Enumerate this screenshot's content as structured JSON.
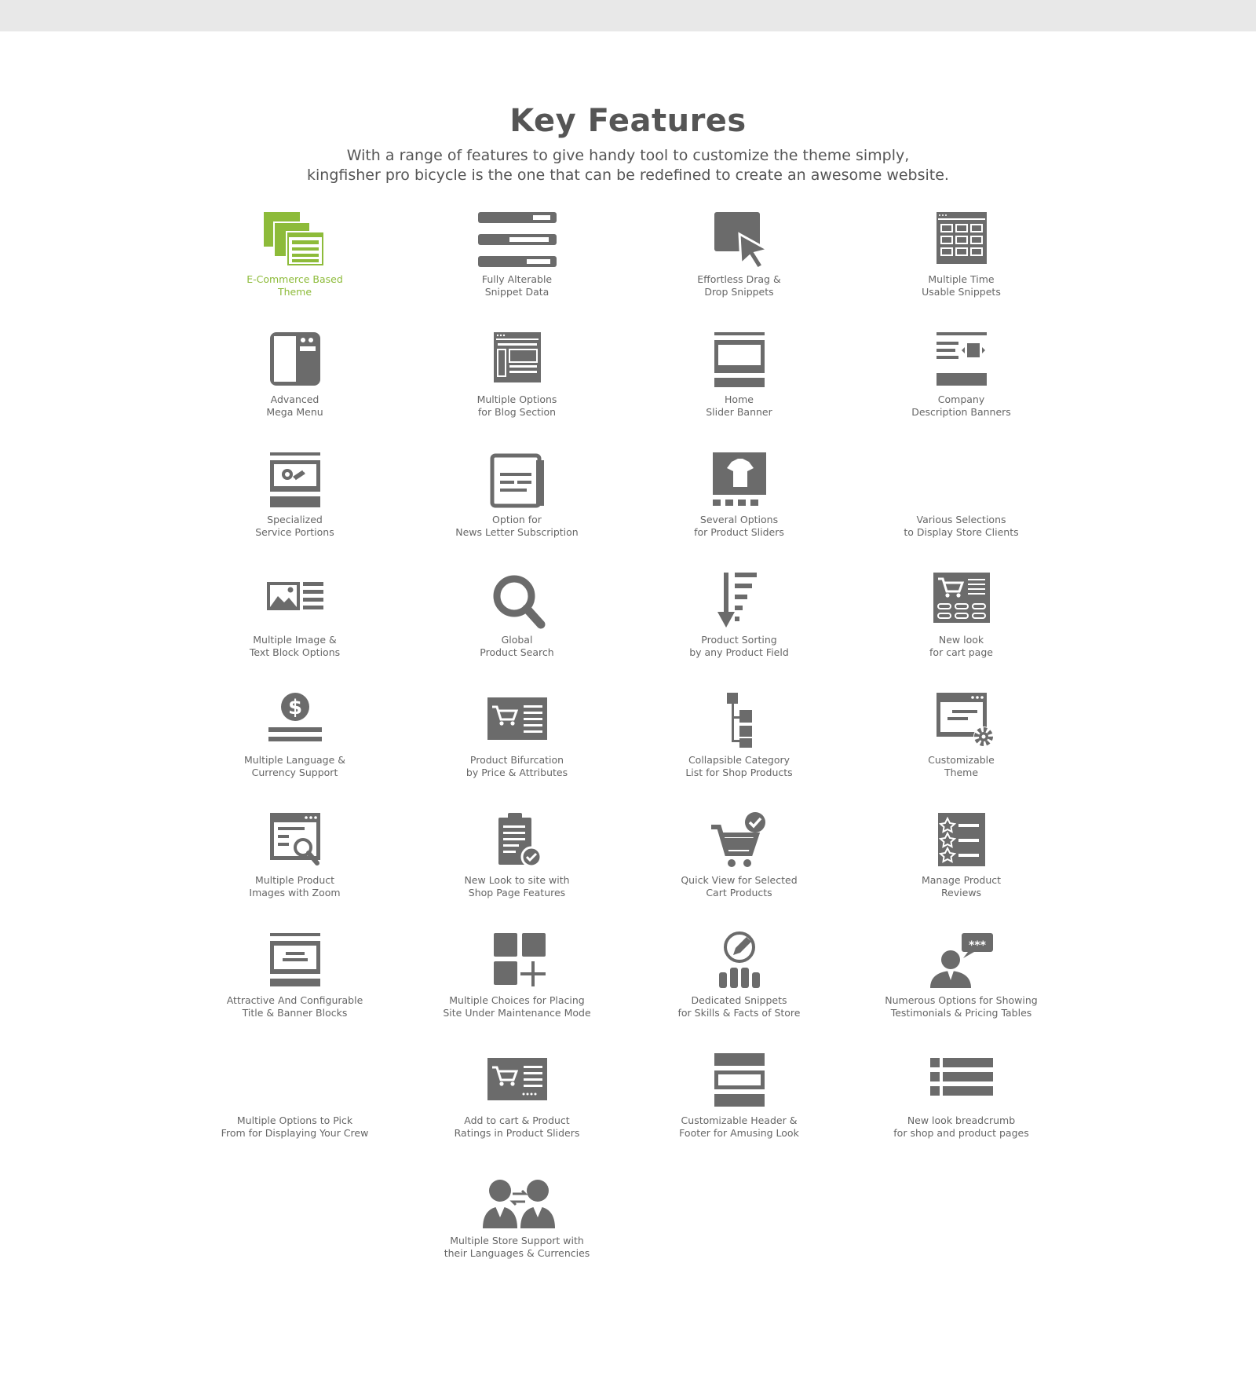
{
  "header": {
    "title": "Key Features",
    "subtitle_line1": "With a range of features to give handy tool to customize the theme simply,",
    "subtitle_line2": "kingfisher pro bicycle is the one that can be redefined to create an awesome website."
  },
  "colors": {
    "icon_gray": "#6b6b6b",
    "accent_green": "#8dbb3a",
    "text_gray": "#555555",
    "topbar": "#e8e8e8"
  },
  "features": [
    {
      "icon": "ecommerce-windows-icon",
      "line1": "E-Commerce Based",
      "line2": "Theme",
      "active": true
    },
    {
      "icon": "snippet-bars-icon",
      "line1": "Fully Alterable",
      "line2": "Snippet Data"
    },
    {
      "icon": "drag-drop-cursor-icon",
      "line1": "Effortless Drag &",
      "line2": "Drop Snippets"
    },
    {
      "icon": "snippet-grid-icon",
      "line1": "Multiple Time",
      "line2": "Usable Snippets"
    },
    {
      "icon": "mega-menu-icon",
      "line1": "Advanced",
      "line2": "Mega Menu"
    },
    {
      "icon": "blog-layout-icon",
      "line1": "Multiple Options",
      "line2": "for Blog Section"
    },
    {
      "icon": "slider-banner-icon",
      "line1": "Home",
      "line2": "Slider Banner"
    },
    {
      "icon": "description-banner-icon",
      "line1": "Company",
      "line2": "Description Banners"
    },
    {
      "icon": "service-portion-icon",
      "line1": "Specialized",
      "line2": "Service Portions"
    },
    {
      "icon": "newsletter-icon",
      "line1": "Option for",
      "line2": "News Letter Subscription"
    },
    {
      "icon": "product-slider-icon",
      "line1": "Several Options",
      "line2": "for Product Sliders"
    },
    {
      "icon": "store-clients-icon",
      "line1": "Various Selections",
      "line2": "to Display Store Clients"
    },
    {
      "icon": "image-text-block-icon",
      "line1": "Multiple Image &",
      "line2": "Text Block Options"
    },
    {
      "icon": "search-icon",
      "line1": "Global",
      "line2": "Product Search"
    },
    {
      "icon": "sort-icon",
      "line1": "Product Sorting",
      "line2": "by any Product Field"
    },
    {
      "icon": "cart-page-icon",
      "line1": "New look",
      "line2": "for cart page"
    },
    {
      "icon": "currency-icon",
      "line1": "Multiple Language &",
      "line2": "Currency Support"
    },
    {
      "icon": "cart-filter-icon",
      "line1": "Product Bifurcation",
      "line2": "by Price & Attributes"
    },
    {
      "icon": "category-tree-icon",
      "line1": "Collapsible Category",
      "line2": "List for Shop Products"
    },
    {
      "icon": "customize-settings-icon",
      "line1": "Customizable",
      "line2": "Theme"
    },
    {
      "icon": "image-zoom-icon",
      "line1": "Multiple Product",
      "line2": "Images with Zoom"
    },
    {
      "icon": "clipboard-check-icon",
      "line1": "New Look to site with",
      "line2": "Shop Page Features"
    },
    {
      "icon": "cart-check-icon",
      "line1": "Quick View for Selected",
      "line2": "Cart Products"
    },
    {
      "icon": "reviews-stars-icon",
      "line1": "Manage Product",
      "line2": "Reviews"
    },
    {
      "icon": "title-banner-icon",
      "line1": "Attractive And Configurable",
      "line2": "Title & Banner Blocks"
    },
    {
      "icon": "maintenance-blocks-icon",
      "line1": "Multiple Choices for Placing",
      "line2": "Site Under Maintenance Mode"
    },
    {
      "icon": "skills-chart-icon",
      "line1": "Dedicated Snippets",
      "line2": "for Skills & Facts of Store"
    },
    {
      "icon": "testimonial-icon",
      "line1": "Numerous Options for Showing",
      "line2": "Testimonials & Pricing Tables"
    },
    {
      "icon": "crew-icon",
      "line1": "Multiple Options to Pick",
      "line2": "From for Displaying Your Crew"
    },
    {
      "icon": "cart-ratings-icon",
      "line1": "Add to cart & Product",
      "line2": "Ratings in Product Sliders"
    },
    {
      "icon": "header-footer-icon",
      "line1": "Customizable Header &",
      "line2": "Footer for Amusing Look"
    },
    {
      "icon": "breadcrumb-list-icon",
      "line1": "New look breadcrumb",
      "line2": "for shop and product pages"
    },
    {
      "icon": "multi-store-icon",
      "line1": "Multiple Store Support with",
      "line2": "their Languages & Currencies"
    }
  ]
}
